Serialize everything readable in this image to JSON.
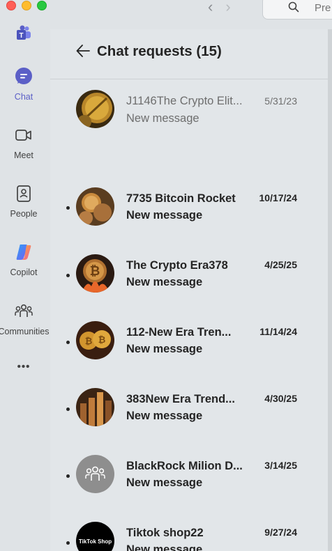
{
  "window": {
    "back_arrow": "‹",
    "forward_arrow": "›",
    "search_placeholder": "Pre"
  },
  "rail": {
    "items": [
      {
        "label": "",
        "icon": "teams-logo-icon"
      },
      {
        "label": "Chat",
        "icon": "chat-icon",
        "active": true
      },
      {
        "label": "Meet",
        "icon": "video-camera-icon"
      },
      {
        "label": "People",
        "icon": "contact-card-icon"
      },
      {
        "label": "Copilot",
        "icon": "copilot-icon"
      },
      {
        "label": "Communities",
        "icon": "communities-icon"
      },
      {
        "label": "•••",
        "icon": "more-icon"
      }
    ]
  },
  "header": {
    "title": "Chat requests (15)"
  },
  "requests": [
    {
      "name": "J1146The Crypto Elit...",
      "preview": "New message",
      "date": "5/31/23",
      "unread": false,
      "avatar": "gold-coin-photo"
    },
    {
      "name": "7735 Bitcoin Rocket",
      "preview": "New message",
      "date": "10/17/24",
      "unread": true,
      "avatar": "coins-photo"
    },
    {
      "name": "The Crypto Era378",
      "preview": "New message",
      "date": "4/25/25",
      "unread": true,
      "avatar": "bitcoin-fire-photo"
    },
    {
      "name": "112-New Era Tren...",
      "preview": "New message",
      "date": "11/14/24",
      "unread": true,
      "avatar": "bitcoin-pair-photo"
    },
    {
      "name": "383New Era Trend...",
      "preview": "New message",
      "date": "4/30/25",
      "unread": true,
      "avatar": "coin-stack-photo"
    },
    {
      "name": "BlackRock Milion D...",
      "preview": "New message",
      "date": "3/14/25",
      "unread": true,
      "avatar": "group-placeholder-icon"
    },
    {
      "name": "Tiktok shop22",
      "preview": "New message",
      "date": "9/27/24",
      "unread": true,
      "avatar": "tiktok-shop-logo"
    }
  ],
  "logo_text": {
    "tiktok_shop": "TikTok Shop"
  },
  "colors": {
    "accent": "#5b5fc7",
    "background": "#dfe3e6",
    "unread_text": "#242424",
    "read_text": "#6e6e6e"
  }
}
